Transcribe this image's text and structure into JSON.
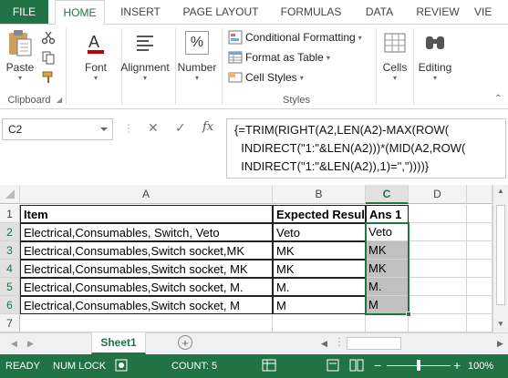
{
  "ribbon_tabs": {
    "file": "FILE",
    "home": "HOME",
    "insert": "INSERT",
    "page_layout": "PAGE LAYOUT",
    "formulas": "FORMULAS",
    "data": "DATA",
    "review": "REVIEW",
    "view": "VIE"
  },
  "clipboard": {
    "paste": "Paste",
    "group": "Clipboard"
  },
  "font": {
    "label": "Font"
  },
  "alignment": {
    "label": "Alignment"
  },
  "number": {
    "label": "Number",
    "icon": "%"
  },
  "styles": {
    "conditional": "Conditional Formatting",
    "format_table": "Format as Table",
    "cell_styles": "Cell Styles",
    "group": "Styles"
  },
  "cells": {
    "label": "Cells"
  },
  "editing": {
    "label": "Editing"
  },
  "name_box": {
    "value": "C2"
  },
  "formula_bar": {
    "fx": "fx",
    "text": "{=TRIM(RIGHT(A2,LEN(A2)-MAX(ROW(\n  INDIRECT(\"1:\"&LEN(A2)))*(MID(A2,ROW(\n  INDIRECT(\"1:\"&LEN(A2)),1)=\",\"))))}"
  },
  "grid": {
    "columns": [
      "A",
      "B",
      "C",
      "D"
    ],
    "rows": [
      {
        "num": "1",
        "a": "Item",
        "b": "Expected Result",
        "c": "Ans 1"
      },
      {
        "num": "2",
        "a": "Electrical,Consumables, Switch, Veto",
        "b": "Veto",
        "c": "Veto"
      },
      {
        "num": "3",
        "a": "Electrical,Consumables,Switch socket,MK",
        "b": "MK",
        "c": "MK"
      },
      {
        "num": "4",
        "a": "Electrical,Consumables,Switch socket,  MK",
        "b": "MK",
        "c": "MK"
      },
      {
        "num": "5",
        "a": "Electrical,Consumables,Switch socket,  M.",
        "b": "M.",
        "c": "M."
      },
      {
        "num": "6",
        "a": "Electrical,Consumables,Switch socket,  M",
        "b": "M",
        "c": "M"
      },
      {
        "num": "7",
        "a": "",
        "b": "",
        "c": ""
      }
    ]
  },
  "sheet_tabs": {
    "active": "Sheet1"
  },
  "status": {
    "ready": "READY",
    "numlock": "NUM LOCK",
    "count": "COUNT: 5",
    "zoom": "100%",
    "minus": "−",
    "plus": "+"
  },
  "colors": {
    "accent": "#217346",
    "selection_fill": "#c0c0c0"
  }
}
